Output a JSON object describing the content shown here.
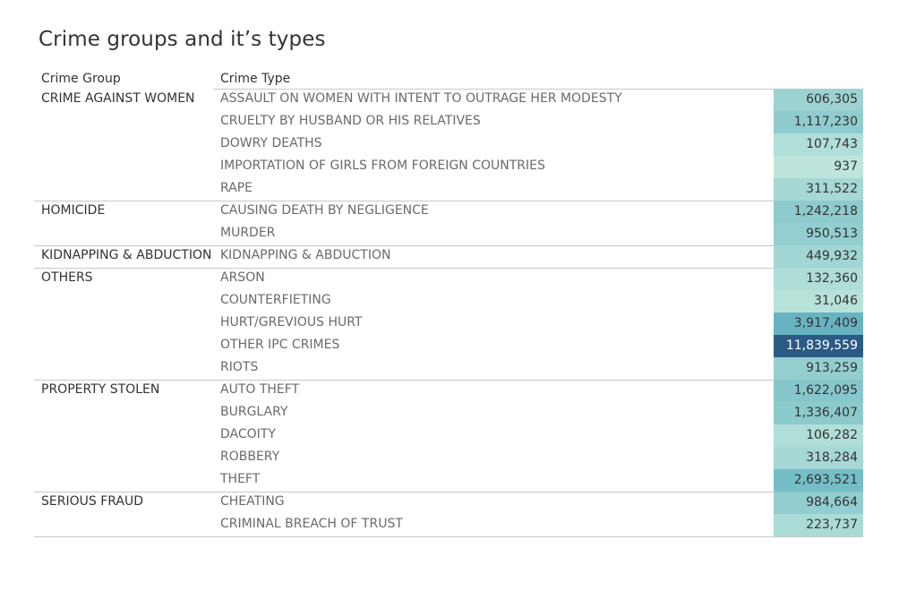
{
  "title": "Crime groups and it’s types",
  "chart_data": {
    "type": "heatmap",
    "title": "Crime groups and it’s types",
    "columns": [
      "Crime Group",
      "Crime Type"
    ],
    "groups": [
      {
        "name": "CRIME AGAINST WOMEN",
        "rows": [
          {
            "type": "ASSAULT ON WOMEN WITH INTENT TO OUTRAGE HER MODESTY",
            "value": 606305,
            "label": "606,305"
          },
          {
            "type": "CRUELTY BY HUSBAND OR HIS RELATIVES",
            "value": 1117230,
            "label": "1,117,230"
          },
          {
            "type": "DOWRY DEATHS",
            "value": 107743,
            "label": "107,743"
          },
          {
            "type": "IMPORTATION OF GIRLS FROM FOREIGN COUNTRIES",
            "value": 937,
            "label": "937"
          },
          {
            "type": "RAPE",
            "value": 311522,
            "label": "311,522"
          }
        ]
      },
      {
        "name": "HOMICIDE",
        "rows": [
          {
            "type": "CAUSING DEATH BY NEGLIGENCE",
            "value": 1242218,
            "label": "1,242,218"
          },
          {
            "type": "MURDER",
            "value": 950513,
            "label": "950,513"
          }
        ]
      },
      {
        "name": "KIDNAPPING & ABDUCTION",
        "rows": [
          {
            "type": "KIDNAPPING & ABDUCTION",
            "value": 449932,
            "label": "449,932"
          }
        ]
      },
      {
        "name": "OTHERS",
        "rows": [
          {
            "type": "ARSON",
            "value": 132360,
            "label": "132,360"
          },
          {
            "type": "COUNTERFIETING",
            "value": 31046,
            "label": "31,046"
          },
          {
            "type": "HURT/GREVIOUS HURT",
            "value": 3917409,
            "label": "3,917,409"
          },
          {
            "type": "OTHER IPC CRIMES",
            "value": 11839559,
            "label": "11,839,559"
          },
          {
            "type": "RIOTS",
            "value": 913259,
            "label": "913,259"
          }
        ]
      },
      {
        "name": "PROPERTY STOLEN",
        "rows": [
          {
            "type": "AUTO THEFT",
            "value": 1622095,
            "label": "1,622,095"
          },
          {
            "type": "BURGLARY",
            "value": 1336407,
            "label": "1,336,407"
          },
          {
            "type": "DACOITY",
            "value": 106282,
            "label": "106,282"
          },
          {
            "type": "ROBBERY",
            "value": 318284,
            "label": "318,284"
          },
          {
            "type": "THEFT",
            "value": 2693521,
            "label": "2,693,521"
          }
        ]
      },
      {
        "name": "SERIOUS FRAUD",
        "rows": [
          {
            "type": "CHEATING",
            "value": 984664,
            "label": "984,664"
          },
          {
            "type": "CRIMINAL BREACH OF TRUST",
            "value": 223737,
            "label": "223,737"
          }
        ]
      }
    ],
    "color_scale": {
      "low": "#bfe6dc",
      "mid": "#6ab8c4",
      "high": "#2c5a86"
    }
  }
}
